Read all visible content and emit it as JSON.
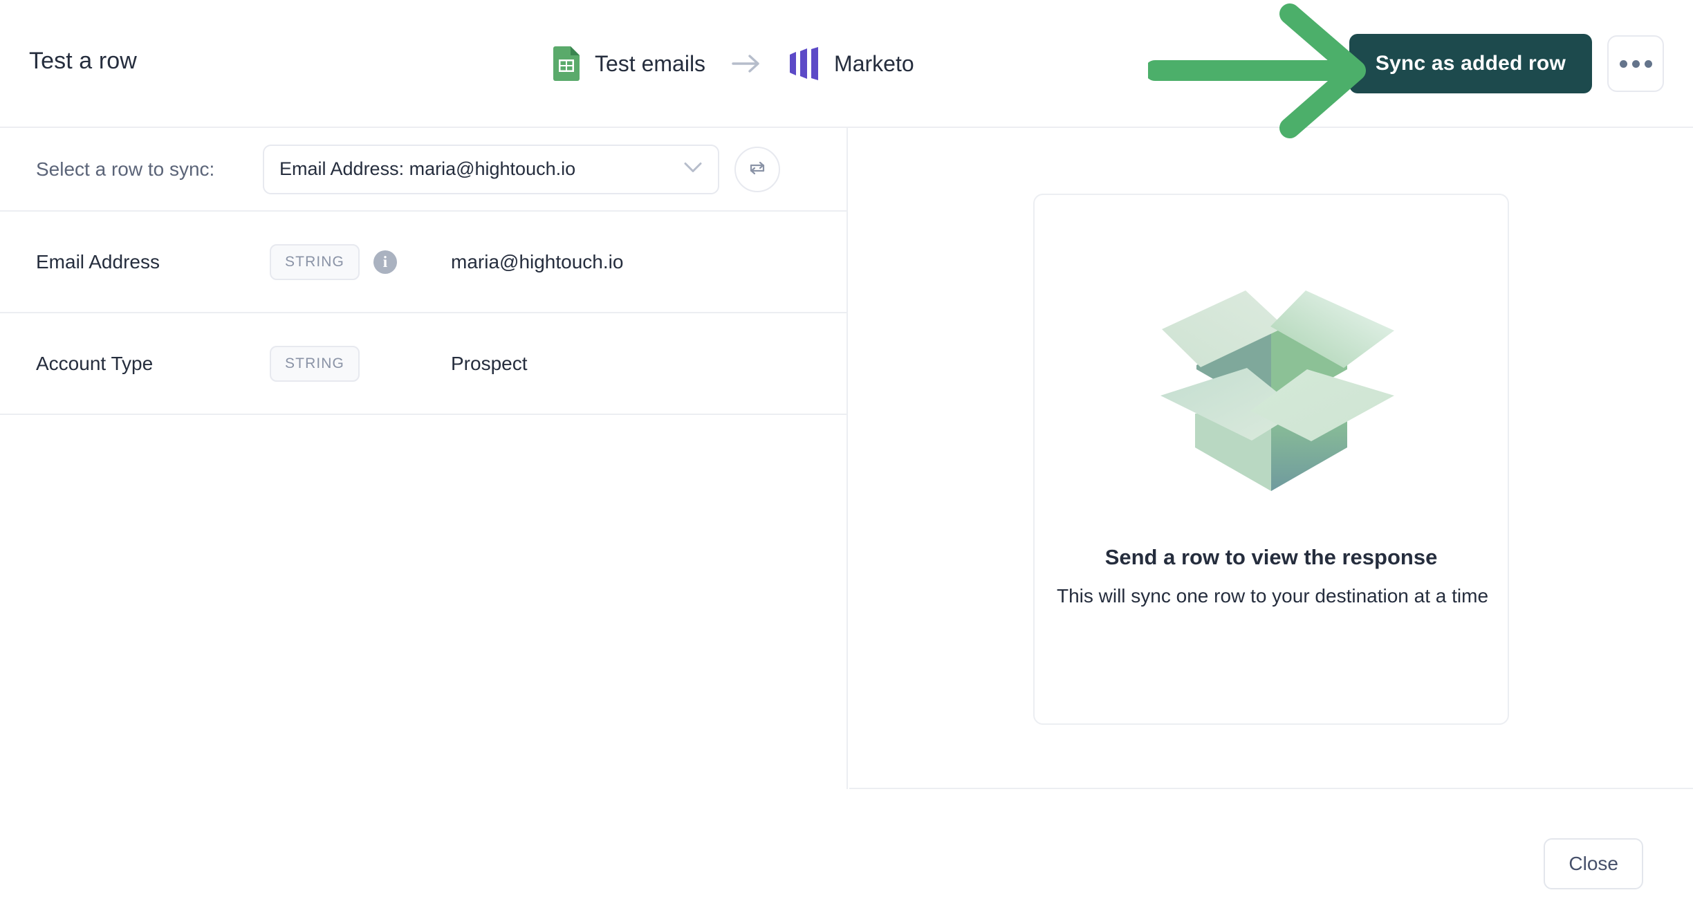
{
  "header": {
    "title": "Test a row",
    "flow": {
      "source": {
        "label": "Test emails",
        "icon": "google-sheets-icon"
      },
      "arrow_icon": "arrow-right-icon",
      "destination": {
        "label": "Marketo",
        "icon": "marketo-icon"
      }
    },
    "primary_button": "Sync as added row",
    "overflow_button_icon": "ellipsis-icon"
  },
  "annotation": {
    "arrow_icon": "green-arrow-annotation",
    "color": "#4caf6a"
  },
  "left_panel": {
    "select_row": {
      "label": "Select a row to sync:",
      "selected_value": "Email Address: maria@hightouch.io",
      "chevron_icon": "chevron-down-icon",
      "refresh_button_icon": "swap-rows-icon"
    },
    "fields": [
      {
        "name": "Email Address",
        "type": "STRING",
        "has_info": true,
        "info_icon": "info-icon",
        "value": "maria@hightouch.io"
      },
      {
        "name": "Account Type",
        "type": "STRING",
        "has_info": false,
        "value": "Prospect"
      }
    ]
  },
  "right_panel": {
    "empty_state": {
      "illustration": "open-box-icon",
      "title": "Send a row to view the response",
      "subtitle": "This will sync one row to your destination at a time"
    }
  },
  "footer": {
    "close_button": "Close"
  },
  "colors": {
    "primary_button_bg": "#1d4a4d",
    "border": "#eceef2",
    "text": "#252d3d",
    "muted_text": "#5b6478",
    "accent_green": "#4caf6a",
    "marketo_purple": "#5c4ac7",
    "sheets_green": "#4a9b5e"
  }
}
